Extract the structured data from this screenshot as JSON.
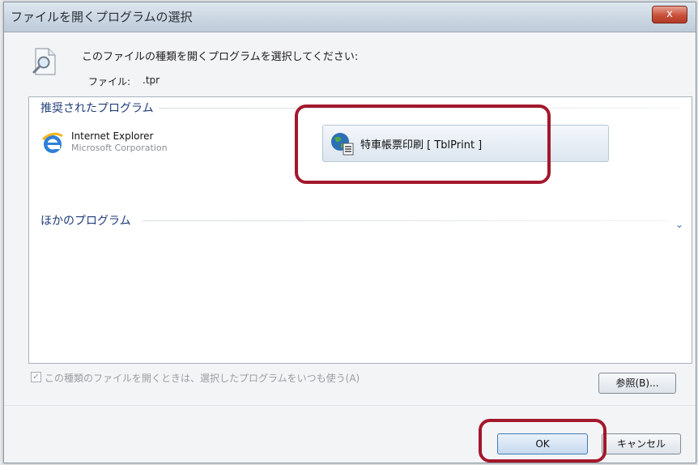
{
  "window": {
    "title": "ファイルを開くプログラムの選択",
    "close_label": "x"
  },
  "header": {
    "prompt": "このファイルの種類を開くプログラムを選択してください:",
    "file_label": "ファイル:",
    "file_value": ".tpr"
  },
  "recommended": {
    "header": "推奨されたプログラム",
    "items": [
      {
        "name": "Internet Explorer",
        "company": "Microsoft Corporation",
        "icon": "internet-explorer-icon"
      },
      {
        "name": "特車帳票印刷 [ TblPrint ]",
        "icon": "tblprint-app-icon",
        "selected": true
      }
    ]
  },
  "other": {
    "header": "ほかのプログラム",
    "expand_icon": "chevron-down-icon"
  },
  "always_use": {
    "checked": true,
    "label": "この種類のファイルを開くときは、選択したプログラムをいつも使う(A)"
  },
  "buttons": {
    "browse": "参照(B)...",
    "ok": "OK",
    "cancel": "キャンセル"
  },
  "colors": {
    "highlight": "#a3182c",
    "section_header": "#1f3c78",
    "accent": "#3b6fb2"
  }
}
